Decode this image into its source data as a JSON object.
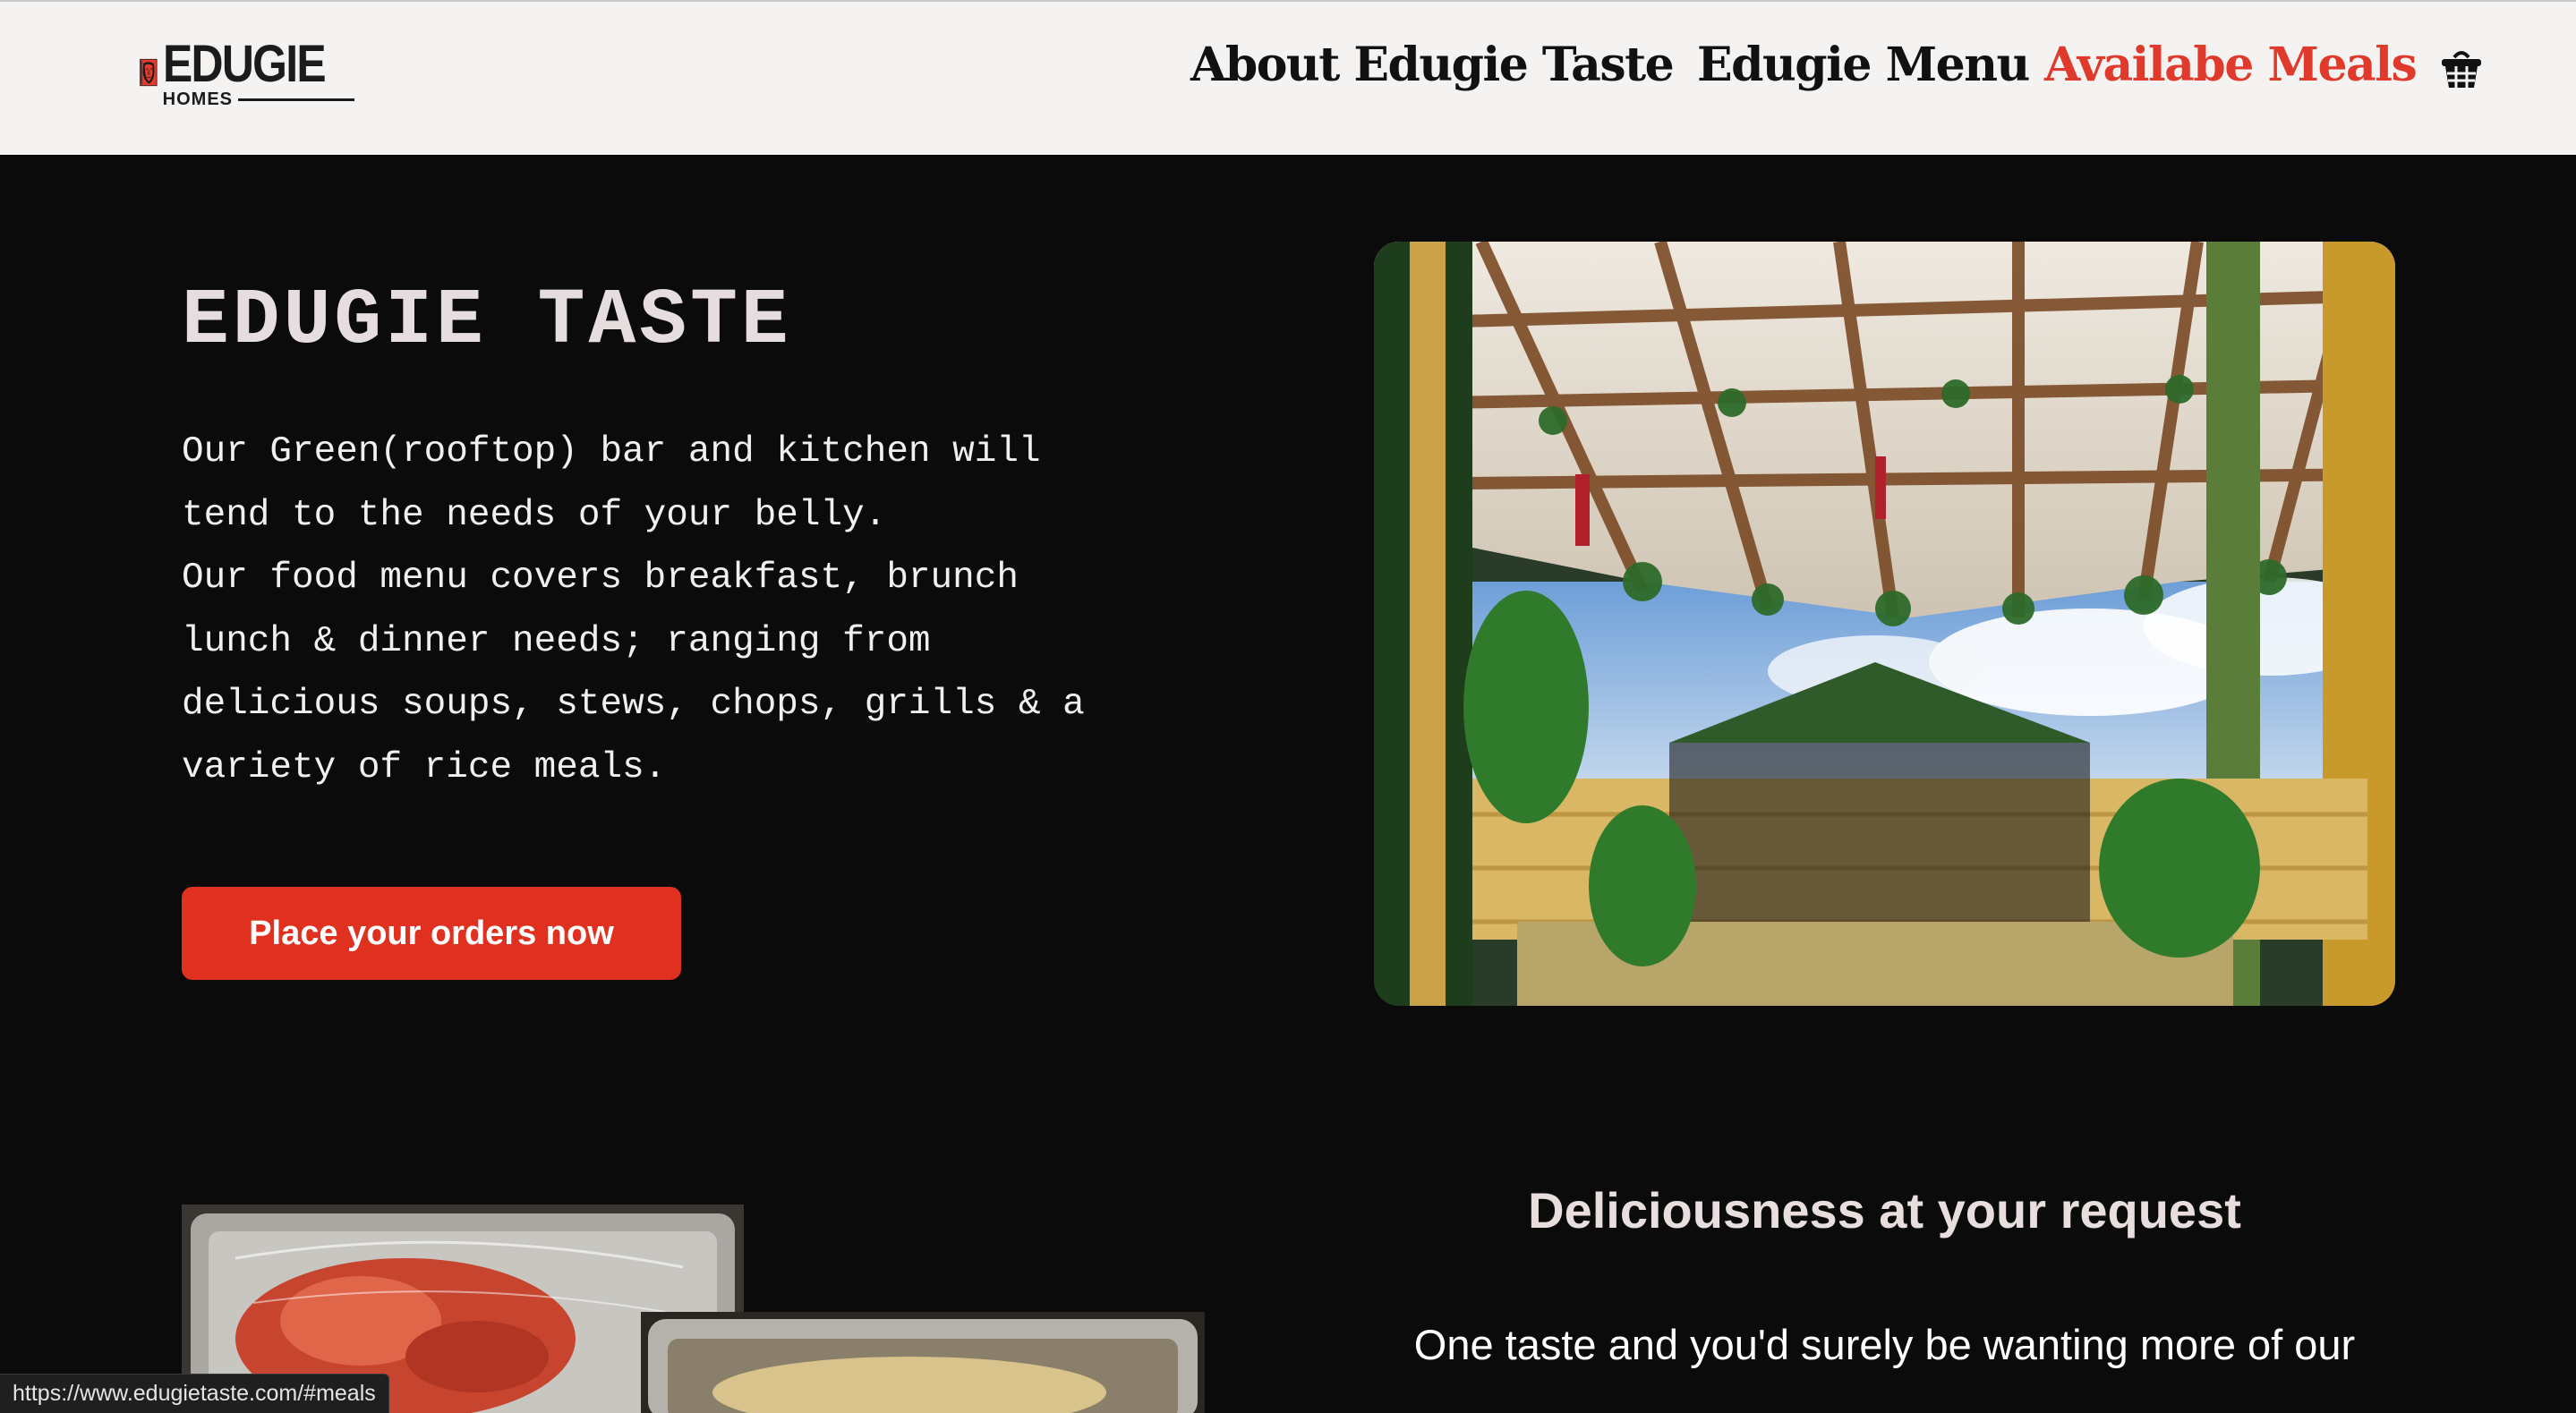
{
  "header": {
    "logo_title": "EDUGIE",
    "logo_subtitle": "HOMES",
    "nav": [
      {
        "label": "About Edugie Taste"
      },
      {
        "label": "Edugie Menu"
      },
      {
        "label": "Availabe Meals"
      }
    ],
    "cart_icon": "shopping-basket-icon"
  },
  "hero": {
    "title": "EDUGIE TASTE",
    "description": "Our Green(rooftop) bar and kitchen will\ntend to the needs of your belly.\nOur food menu covers breakfast, brunch\nlunch & dinner needs; ranging from\ndelicious soups, stews, chops, grills & a\nvariety of rice meals.",
    "cta_label": "Place your orders now"
  },
  "section": {
    "heading": "Deliciousness at your request",
    "text": "One taste and you'd surely be wanting more of our"
  },
  "status_bar": {
    "url": "https://www.edugietaste.com/#meals"
  },
  "colors": {
    "accent": "#e0301f",
    "background": "#0b0b0c",
    "header_bg": "#f4f3f1",
    "active_nav": "#e03a2c"
  }
}
